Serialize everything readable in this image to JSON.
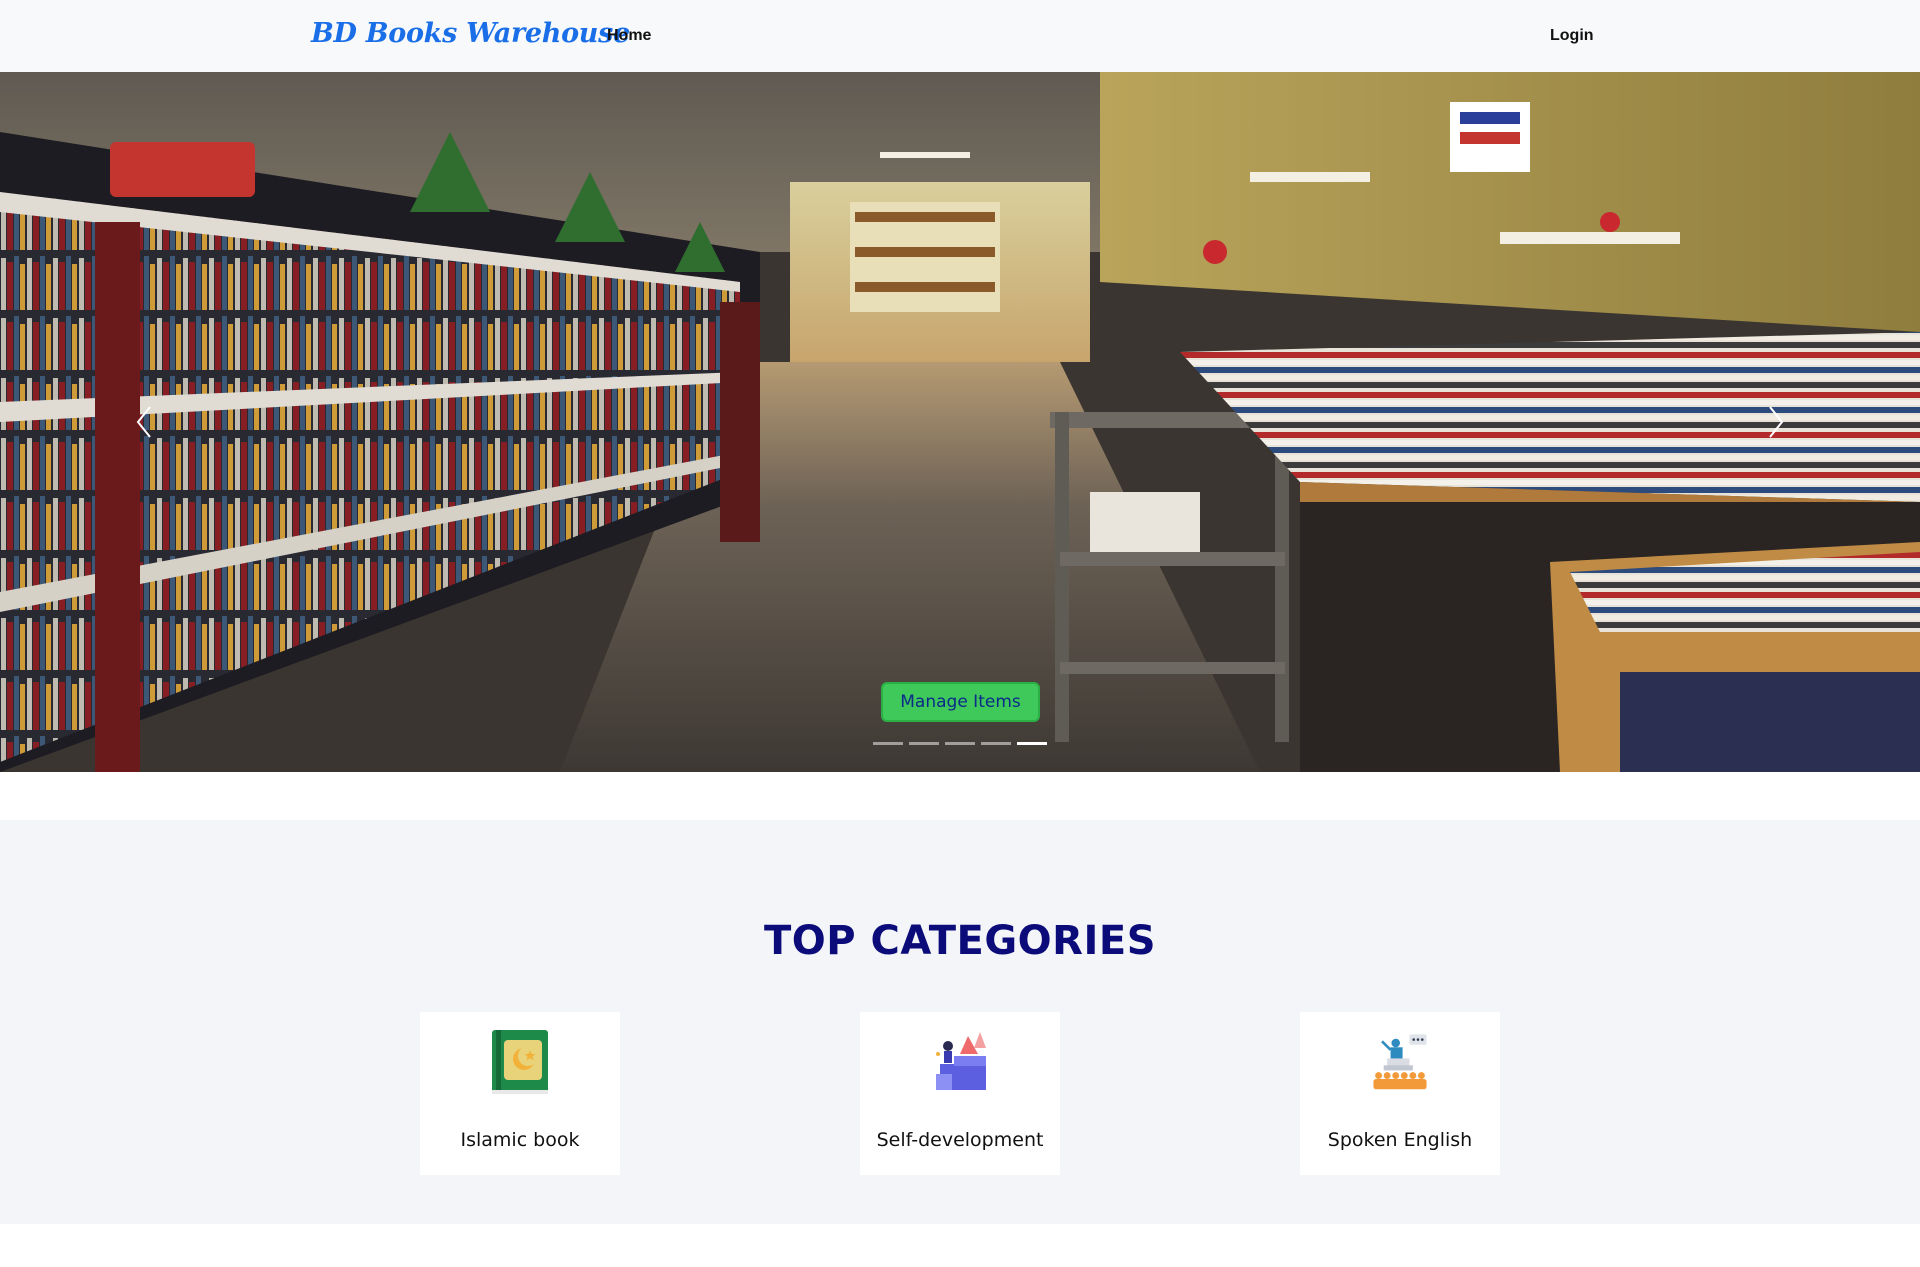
{
  "navbar": {
    "brand": "BD Books Warehouse",
    "home_label": "Home",
    "login_label": "Login"
  },
  "hero": {
    "image": "bookstore-interior-photo",
    "manage_button_label": "Manage Items",
    "prev_icon": "chevron-left-icon",
    "next_icon": "chevron-right-icon",
    "slide_count": 5,
    "active_slide": 5
  },
  "categories": {
    "title": "TOP CATEGORIES",
    "items": [
      {
        "label": "Islamic book",
        "icon": "quran-book-icon"
      },
      {
        "label": "Self-development",
        "icon": "self-development-icon"
      },
      {
        "label": "Spoken English",
        "icon": "speaker-audience-icon"
      }
    ]
  }
}
